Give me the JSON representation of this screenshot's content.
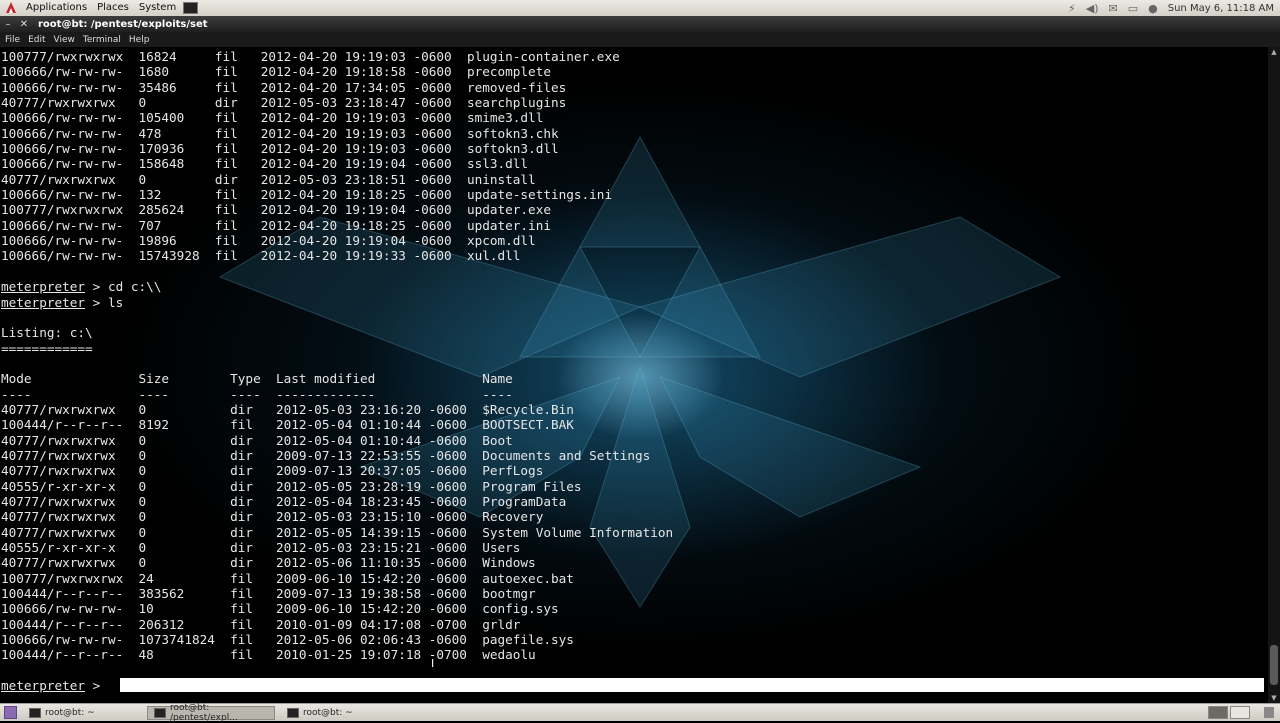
{
  "top_panel": {
    "menus": [
      "Applications",
      "Places",
      "System"
    ],
    "clock": "Sun May  6, 11:18 AM"
  },
  "window": {
    "title": "root@bt: /pentest/exploits/set",
    "menu": [
      "File",
      "Edit",
      "View",
      "Terminal",
      "Help"
    ]
  },
  "terminal": {
    "lines": [
      "100777/rwxrwxrwx  16824     fil   2012-04-20 19:19:03 -0600  plugin-container.exe",
      "100666/rw-rw-rw-  1680      fil   2012-04-20 19:18:58 -0600  precomplete",
      "100666/rw-rw-rw-  35486     fil   2012-04-20 17:34:05 -0600  removed-files",
      "40777/rwxrwxrwx   0         dir   2012-05-03 23:18:47 -0600  searchplugins",
      "100666/rw-rw-rw-  105400    fil   2012-04-20 19:19:03 -0600  smime3.dll",
      "100666/rw-rw-rw-  478       fil   2012-04-20 19:19:03 -0600  softokn3.chk",
      "100666/rw-rw-rw-  170936    fil   2012-04-20 19:19:03 -0600  softokn3.dll",
      "100666/rw-rw-rw-  158648    fil   2012-04-20 19:19:04 -0600  ssl3.dll",
      "40777/rwxrwxrwx   0         dir   2012-05-03 23:18:51 -0600  uninstall",
      "100666/rw-rw-rw-  132       fil   2012-04-20 19:18:25 -0600  update-settings.ini",
      "100777/rwxrwxrwx  285624    fil   2012-04-20 19:19:04 -0600  updater.exe",
      "100666/rw-rw-rw-  707       fil   2012-04-20 19:18:25 -0600  updater.ini",
      "100666/rw-rw-rw-  19896     fil   2012-04-20 19:19:04 -0600  xpcom.dll",
      "100666/rw-rw-rw-  15743928  fil   2012-04-20 19:19:33 -0600  xul.dll",
      "",
      "meterpreter > cd c:\\\\",
      "meterpreter > ls",
      "",
      "Listing: c:\\",
      "============",
      "",
      "Mode              Size        Type  Last modified              Name",
      "----              ----        ----  -------------              ----",
      "40777/rwxrwxrwx   0           dir   2012-05-03 23:16:20 -0600  $Recycle.Bin",
      "100444/r--r--r--  8192        fil   2012-05-04 01:10:44 -0600  BOOTSECT.BAK",
      "40777/rwxrwxrwx   0           dir   2012-05-04 01:10:44 -0600  Boot",
      "40777/rwxrwxrwx   0           dir   2009-07-13 22:53:55 -0600  Documents and Settings",
      "40777/rwxrwxrwx   0           dir   2009-07-13 20:37:05 -0600  PerfLogs",
      "40555/r-xr-xr-x   0           dir   2012-05-05 23:28:19 -0600  Program Files",
      "40777/rwxrwxrwx   0           dir   2012-05-04 18:23:45 -0600  ProgramData",
      "40777/rwxrwxrwx   0           dir   2012-05-03 23:15:10 -0600  Recovery",
      "40777/rwxrwxrwx   0           dir   2012-05-05 14:39:15 -0600  System Volume Information",
      "40555/r-xr-xr-x   0           dir   2012-05-03 23:15:21 -0600  Users",
      "40777/rwxrwxrwx   0           dir   2012-05-06 11:10:35 -0600  Windows",
      "100777/rwxrwxrwx  24          fil   2009-06-10 15:42:20 -0600  autoexec.bat",
      "100444/r--r--r--  383562      fil   2009-07-13 19:38:58 -0600  bootmgr",
      "100666/rw-rw-rw-  10          fil   2009-06-10 15:42:20 -0600  config.sys",
      "100444/r--r--r--  206312      fil   2010-01-09 04:17:08 -0700  grldr",
      "100666/rw-rw-rw-  1073741824  fil   2012-05-06 02:06:43 -0600  pagefile.sys",
      "100444/r--r--r--  48          fil   2010-01-25 19:07:18 -0700  wedaolu",
      ""
    ],
    "prompt": "meterpreter",
    "prompt_suffix": " > ",
    "input_value": ""
  },
  "taskbar": {
    "tasks": [
      {
        "label": "root@bt: ~",
        "active": false
      },
      {
        "label": "root@bt: /pentest/expl...",
        "active": true
      },
      {
        "label": "root@bt: ~",
        "active": false
      }
    ]
  },
  "colors": {
    "terminal_bg": "#000000",
    "terminal_fg": "#e6e6e6",
    "wallpaper_glow": "#2a8fc0",
    "panel_bg": "#d4d0c8"
  }
}
